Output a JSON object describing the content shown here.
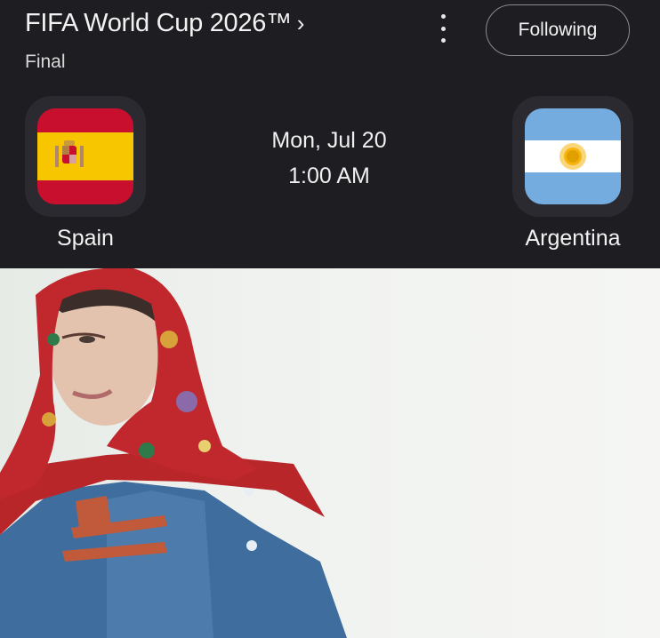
{
  "header": {
    "title": "FIFA World Cup 2026™",
    "chevron": "›",
    "stage": "Final",
    "follow_label": "Following",
    "more_icon": "more-vert-icon"
  },
  "match": {
    "date": "Mon, Jul 20",
    "time": "1:00 AM",
    "home": {
      "name": "Spain",
      "flag": "spain-flag-icon"
    },
    "away": {
      "name": "Argentina",
      "flag": "argentina-flag-icon"
    }
  },
  "colors": {
    "card_bg": "#1d1d22",
    "spain_red": "#c8102e",
    "spain_yellow": "#f7c600",
    "argentina_blue": "#74acdf",
    "argentina_sun": "#f6b40e"
  }
}
